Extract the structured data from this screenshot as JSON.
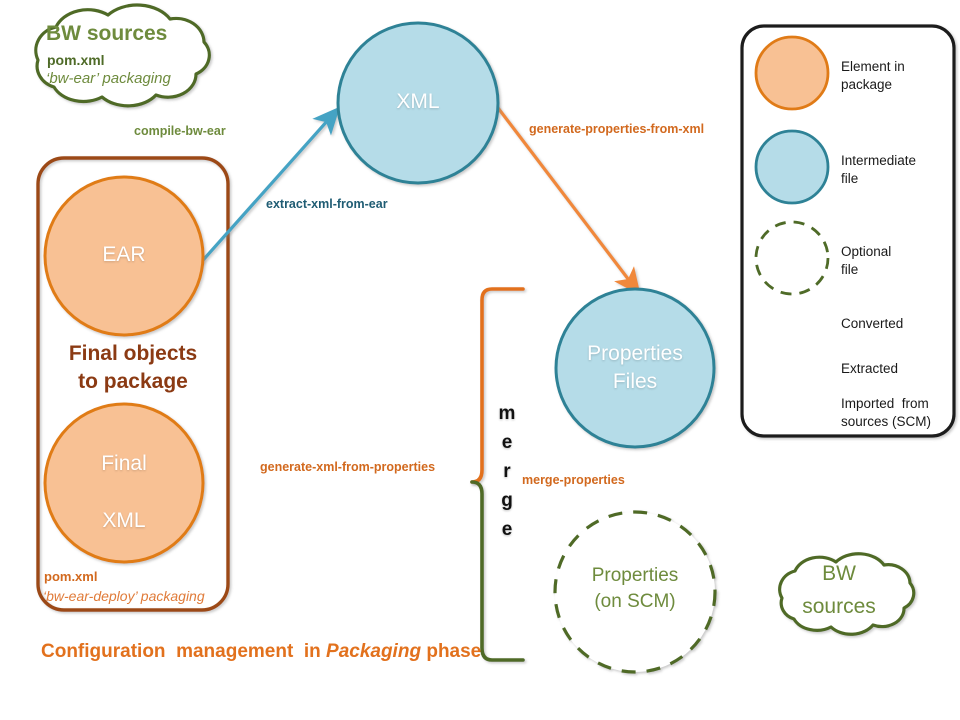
{
  "diagram": {
    "caption": {
      "prefix": "Configuration  management  in ",
      "emphasis": "Packaging",
      "suffix": " phase"
    },
    "package_box": {
      "title_line1": "Final objects",
      "title_line2": "to package",
      "pom_label": "pom.xml",
      "pom_packaging": "‘bw-ear-deploy’ packaging"
    },
    "source_cloud": {
      "title": "BW sources",
      "pom_label": "pom.xml",
      "pom_packaging": "‘bw-ear’ packaging"
    },
    "scm_cloud": {
      "line1": "BW",
      "line2": "sources"
    },
    "nodes": {
      "ear": {
        "label": "EAR"
      },
      "xml": {
        "label": "XML"
      },
      "final_xml": {
        "line1": "Final",
        "line2": "XML"
      },
      "properties_files": {
        "line1": "Properties",
        "line2": "Files"
      },
      "properties_scm": {
        "line1": "Properties",
        "line2": "(on SCM)"
      }
    },
    "edges": {
      "compile_bw_ear": "compile-bw-ear",
      "extract_xml_from_ear": "extract-xml-from-ear",
      "generate_properties_from_xml": "generate-properties-from-xml",
      "generate_xml_from_properties": "generate-xml-from-properties",
      "merge_properties": "merge-properties"
    },
    "merge_bracket": {
      "letters": [
        "m",
        "e",
        "r",
        "g",
        "e"
      ]
    }
  },
  "legend": {
    "items": [
      {
        "kind": "circle-orange",
        "label_line1": "Element in",
        "label_line2": "package"
      },
      {
        "kind": "circle-blue",
        "label_line1": "Intermediate",
        "label_line2": "file"
      },
      {
        "kind": "circle-dashed",
        "label_line1": "Optional",
        "label_line2": "file"
      },
      {
        "kind": "arrow-orange",
        "label_line1": "Converted",
        "label_line2": ""
      },
      {
        "kind": "arrow-blue",
        "label_line1": "Extracted",
        "label_line2": ""
      },
      {
        "kind": "arrow-green",
        "label_line1": "Imported  from",
        "label_line2": "sources (SCM)"
      }
    ]
  },
  "colors": {
    "orange_fill": "#F8C194",
    "orange_stroke": "#E07B17",
    "blue_fill": "#B5DCE8",
    "blue_stroke": "#2E8296",
    "green_dark": "#4F6B28",
    "green_arrow": "#8CB04A",
    "orange_arrow": "#F0883B",
    "blue_arrow": "#45A3C4",
    "box_stroke": "#9C4A16",
    "legend_stroke": "#1c1c1c"
  }
}
